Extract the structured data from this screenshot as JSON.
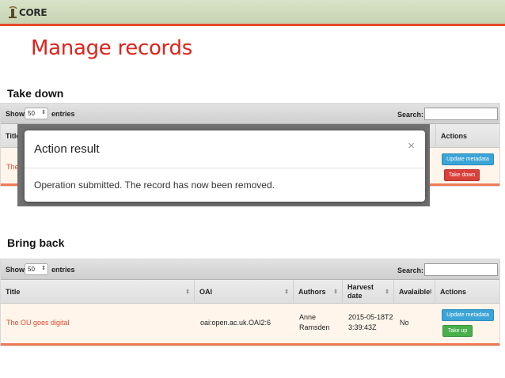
{
  "logo": {
    "text": "CORE"
  },
  "page_title": "Manage records",
  "sections": {
    "take_down": "Take down",
    "bring_back": "Bring back"
  },
  "table_controls": {
    "show_label": "Show",
    "page_size": "50",
    "entries_label": "entries",
    "search_label": "Search:"
  },
  "modal": {
    "title": "Action result",
    "close": "×",
    "message": "Operation submitted. The record has now been removed."
  },
  "top_table": {
    "headers": {
      "title": "Title",
      "actions": "Actions"
    },
    "row": {
      "title": "The",
      "update_button": "Update metadata",
      "take_down_button": "Take down"
    }
  },
  "bottom_table": {
    "headers": {
      "title": "Title",
      "oai": "OAI",
      "authors": "Authors",
      "harvest_date": "Harvest date",
      "available": "Avalaible",
      "actions": "Actions"
    },
    "row": {
      "title": "The OU goes digital",
      "oai": "oai:open.ac.uk.OAI2:6",
      "authors": "Anne Ramsden",
      "harvest_date": "2015-05-18T23:39:43Z",
      "available": "No",
      "update_button": "Update metadata",
      "take_up_button": "Take up"
    }
  },
  "colors": {
    "accent_red": "#e0231c",
    "link_orange": "#e8492d",
    "button_blue": "#3ca4d6",
    "button_red": "#d9403a",
    "button_green": "#49b04c"
  }
}
